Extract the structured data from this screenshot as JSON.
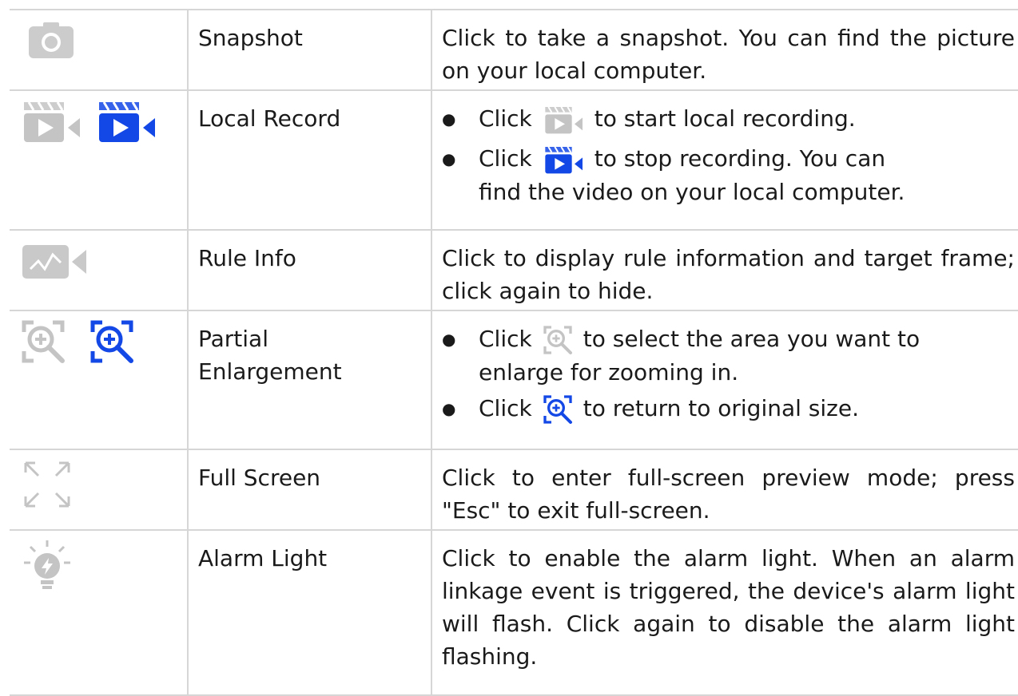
{
  "rows": [
    {
      "icon": "camera-icon",
      "name": "Snapshot",
      "desc": "Click to take a snapshot. You can find the picture on your local computer."
    },
    {
      "icon": "video-record-icon",
      "name": "Local Record",
      "b1_pre": "Click",
      "b1_post": "to start local recording.",
      "b2_pre": "Click",
      "b2_post": "to stop recording. You can",
      "b2_cont": "find the video on your local computer."
    },
    {
      "icon": "rule-info-icon",
      "name": "Rule Info",
      "desc": "Click to display rule information and target frame; click again to hide."
    },
    {
      "icon": "zoom-in-icon",
      "name_l1": "Partial",
      "name_l2": "Enlargement",
      "b1_pre": "Click",
      "b1_post": "to select the area you want to",
      "b1_cont": "enlarge for zooming in.",
      "b2_pre": "Click",
      "b2_post": "to return to original size."
    },
    {
      "icon": "fullscreen-icon",
      "name": "Full Screen",
      "desc": "Click to enter full-screen preview mode; press \"Esc\" to exit full-screen."
    },
    {
      "icon": "alarm-light-icon",
      "name": "Alarm Light",
      "desc": "Click to enable the alarm light. When an alarm linkage event is triggered, the device's alarm light will flash. Click again to disable the alarm light flashing."
    }
  ],
  "colors": {
    "icon_inactive": "#c4c4c4",
    "icon_active": "#1448e6",
    "border": "#d6d6d6"
  }
}
